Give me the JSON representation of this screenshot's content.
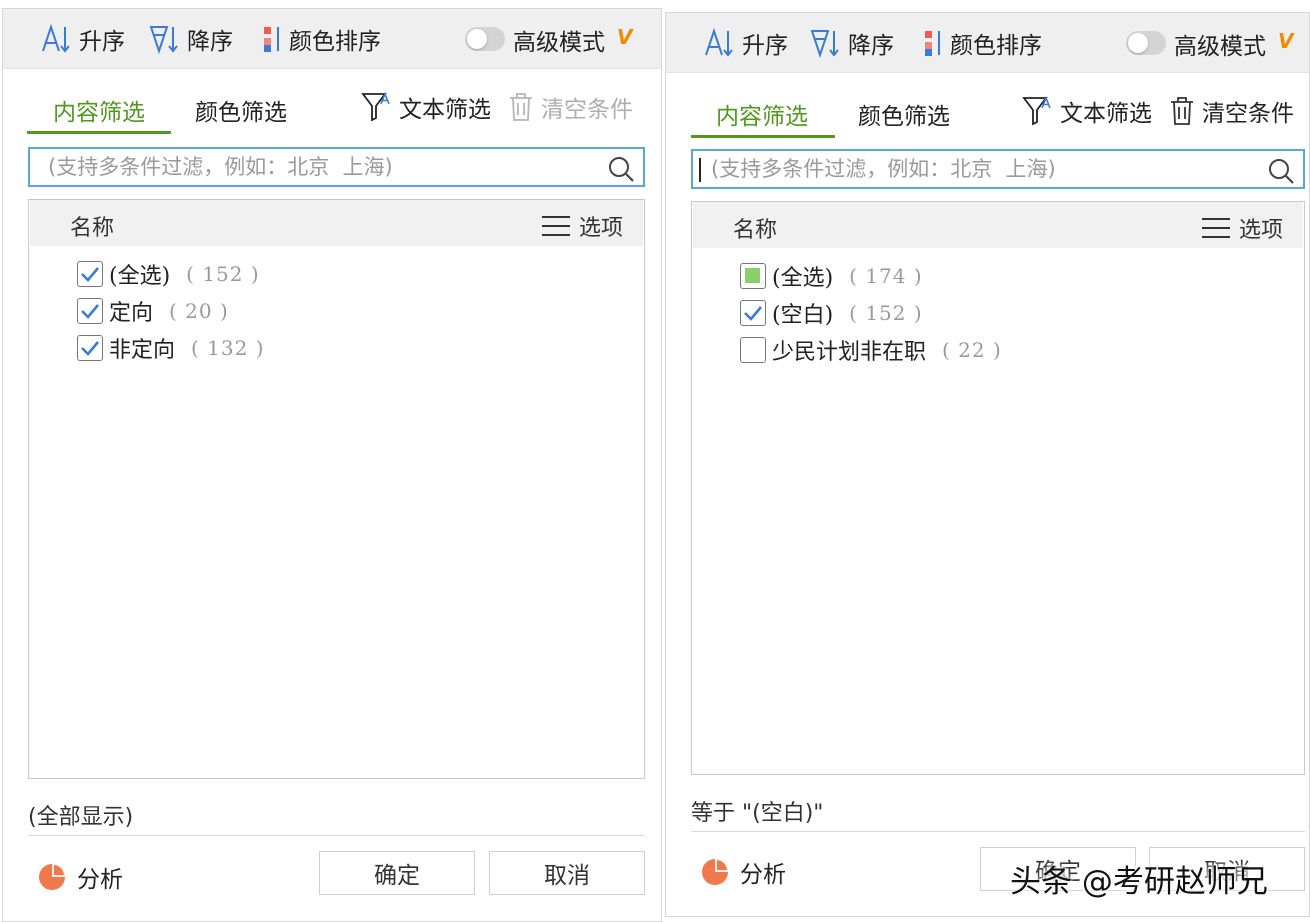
{
  "colors": {
    "accent_green": "#4f9a1e",
    "search_border": "#5aa7dc",
    "check_blue": "#3a7bd5",
    "vip_orange": "#f08a00",
    "partial_green": "#8bd06c",
    "analyze_orange": "#f0784a"
  },
  "left": {
    "toolbar": {
      "asc": "升序",
      "desc": "降序",
      "color_sort": "颜色排序",
      "advanced": "高级模式",
      "vip": "V"
    },
    "tabs": {
      "content": "内容筛选",
      "color": "颜色筛选",
      "text_filter": "文本筛选",
      "clear": "清空条件"
    },
    "search": {
      "placeholder": "(支持多条件过滤，例如：北京  上海)"
    },
    "list": {
      "header_name": "名称",
      "header_options": "选项",
      "items": [
        {
          "label": "(全选)",
          "count": "( 152 )",
          "state": "checked"
        },
        {
          "label": "定向",
          "count": "( 20 )",
          "state": "checked"
        },
        {
          "label": "非定向",
          "count": "( 132 )",
          "state": "checked"
        }
      ]
    },
    "status": "(全部显示)",
    "footer": {
      "analyze": "分析",
      "ok": "确定",
      "cancel": "取消"
    }
  },
  "right": {
    "toolbar": {
      "asc": "升序",
      "desc": "降序",
      "color_sort": "颜色排序",
      "advanced": "高级模式",
      "vip": "V"
    },
    "tabs": {
      "content": "内容筛选",
      "color": "颜色筛选",
      "text_filter": "文本筛选",
      "clear": "清空条件"
    },
    "search": {
      "placeholder": "(支持多条件过滤，例如：北京  上海)"
    },
    "list": {
      "header_name": "名称",
      "header_options": "选项",
      "items": [
        {
          "label": "(全选)",
          "count": "( 174 )",
          "state": "partial"
        },
        {
          "label": "(空白)",
          "count": "( 152 )",
          "state": "checked"
        },
        {
          "label": "少民计划非在职",
          "count": "( 22 )",
          "state": "unchecked"
        }
      ]
    },
    "status": "等于 \"(空白)\"",
    "footer": {
      "analyze": "分析",
      "ok": "确定",
      "cancel": "取消"
    }
  },
  "watermark": "头条 @考研赵师兄"
}
